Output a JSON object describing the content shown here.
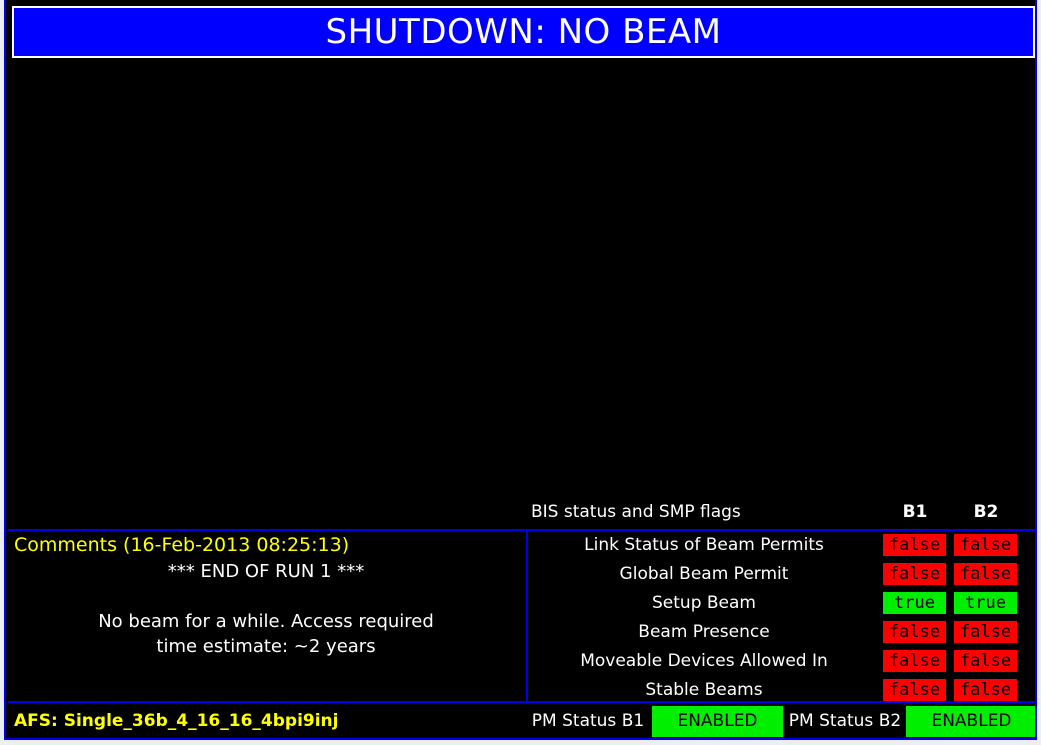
{
  "banner": {
    "text": "SHUTDOWN: NO BEAM",
    "background_color": "#0000ff",
    "text_color": "#ffffff"
  },
  "comments": {
    "title": "Comments (16-Feb-2013 08:25:13)",
    "title_color": "#ffff00",
    "body": "*** END OF RUN 1 ***\n\nNo beam for a while. Access required\ntime estimate: ~2 years"
  },
  "bis": {
    "title": "BIS status and SMP flags",
    "columns": [
      "B1",
      "B2"
    ],
    "rows": [
      {
        "label": "Link Status of Beam Permits",
        "b1": "false",
        "b2": "false",
        "b1_state": "false",
        "b2_state": "false"
      },
      {
        "label": "Global Beam Permit",
        "b1": "false",
        "b2": "false",
        "b1_state": "false",
        "b2_state": "false"
      },
      {
        "label": "Setup Beam",
        "b1": "true",
        "b2": "true",
        "b1_state": "true",
        "b2_state": "true"
      },
      {
        "label": "Beam Presence",
        "b1": "false",
        "b2": "false",
        "b1_state": "false",
        "b2_state": "false"
      },
      {
        "label": "Moveable Devices Allowed In",
        "b1": "false",
        "b2": "false",
        "b1_state": "false",
        "b2_state": "false"
      },
      {
        "label": "Stable Beams",
        "b1": "false",
        "b2": "false",
        "b1_state": "false",
        "b2_state": "false"
      }
    ],
    "true_color": "#00ee00",
    "false_color": "#ff0000"
  },
  "status_bar": {
    "afs": "AFS: Single_36b_4_16_16_4bpi9inj",
    "afs_color": "#ffff00",
    "pm_status_b1_label": "PM Status B1",
    "pm_status_b1_value": "ENABLED",
    "pm_status_b2_label": "PM Status B2",
    "pm_status_b2_value": "ENABLED",
    "enabled_color": "#00ee00"
  }
}
